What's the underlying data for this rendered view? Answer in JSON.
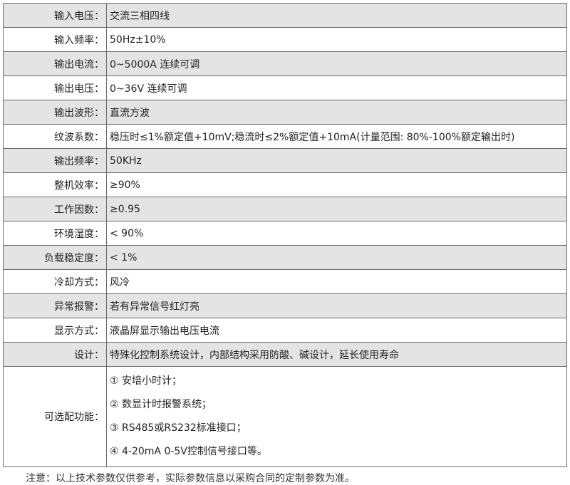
{
  "rows": [
    {
      "label": "输入电压：",
      "value": "交流三相四线"
    },
    {
      "label": "输入频率：",
      "value": "50Hz±10%"
    },
    {
      "label": "输出电流：",
      "value": "0~5000A 连续可调"
    },
    {
      "label": "输出电压：",
      "value": "0~36V 连续可调"
    },
    {
      "label": "输出波形：",
      "value": "直流方波"
    },
    {
      "label": "纹波系数：",
      "value": "稳压时≤1%额定值+10mV;稳流时≤2%额定值+10mA(计量范围: 80%-100%额定输出时)"
    },
    {
      "label": "输出频率：",
      "value": "50KHz"
    },
    {
      "label": "整机效率：",
      "value": "≥90%"
    },
    {
      "label": "工作因数：",
      "value": "≥0.95"
    },
    {
      "label": "环境湿度：",
      "value": "< 90%"
    },
    {
      "label": "负载稳定度：",
      "value": "< 1%"
    },
    {
      "label": "冷却方式：",
      "value": "风冷"
    },
    {
      "label": "异常报警：",
      "value": "若有异常信号红灯亮"
    },
    {
      "label": "显示方式：",
      "value": "液晶屏显示输出电压电流"
    },
    {
      "label": "设计：",
      "value": "特殊化控制系统设计，内部结构采用防酸、碱设计，延长使用寿命"
    }
  ],
  "optional": {
    "label": "可选配功能：",
    "items": [
      "① 安培小时计；",
      "② 数显计时报警系统；",
      "③ RS485或RS232标准接口；",
      "④ 4-20mA 0-5V控制信号接口等。"
    ]
  },
  "note": "注意：以上技术参数仅供参考，实际参数信息以采购合同的定制参数为准。"
}
